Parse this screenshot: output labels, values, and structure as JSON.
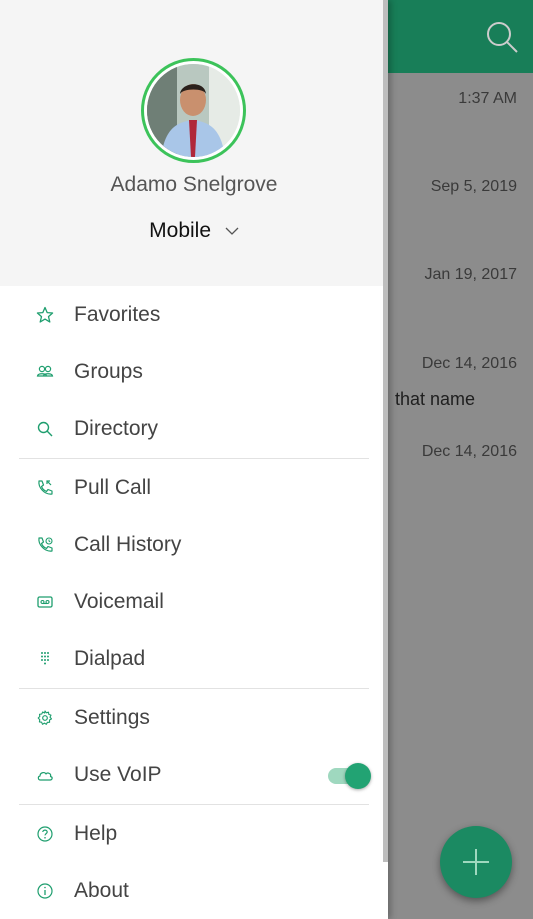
{
  "background": {
    "rows": [
      {
        "time": "1:37 AM"
      },
      {
        "time": "Sep 5, 2019"
      },
      {
        "time": "Jan 19, 2017"
      },
      {
        "time": "Dec 14, 2016",
        "snippet": "that name"
      },
      {
        "time": "Dec 14, 2016"
      }
    ],
    "accent": "#1e9e6e"
  },
  "profile": {
    "name": "Adamo Snelgrove",
    "device": "Mobile"
  },
  "menu": {
    "favorites": "Favorites",
    "groups": "Groups",
    "directory": "Directory",
    "pull_call": "Pull Call",
    "call_history": "Call History",
    "voicemail": "Voicemail",
    "dialpad": "Dialpad",
    "settings": "Settings",
    "use_voip": "Use VoIP",
    "help": "Help",
    "about": "About"
  },
  "use_voip_enabled": true,
  "icons": {
    "favorites": "star-icon",
    "groups": "people-icon",
    "directory": "search-icon",
    "pull_call": "phone-pull-icon",
    "call_history": "phone-history-icon",
    "voicemail": "voicemail-icon",
    "dialpad": "dialpad-icon",
    "settings": "gear-icon",
    "use_voip": "cloud-icon",
    "help": "help-circle-icon",
    "about": "info-circle-icon"
  }
}
